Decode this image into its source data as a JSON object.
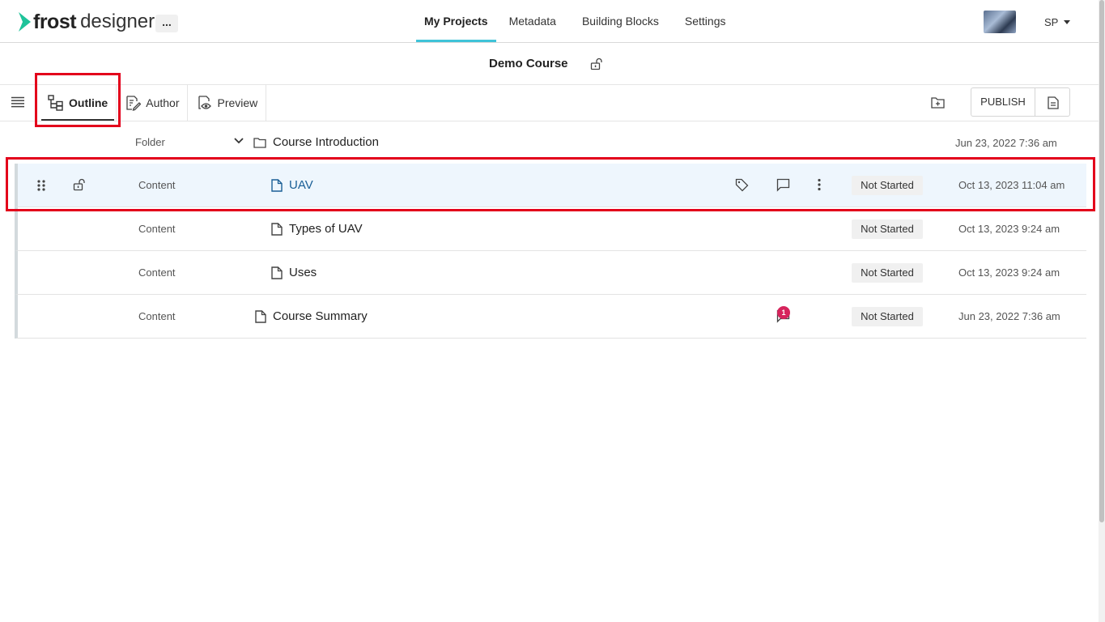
{
  "header": {
    "brand_bold": "frost",
    "brand_light": "designer",
    "more_label": "...",
    "nav": [
      {
        "label": "My Projects",
        "active": true
      },
      {
        "label": "Metadata",
        "active": false
      },
      {
        "label": "Building Blocks",
        "active": false
      },
      {
        "label": "Settings",
        "active": false
      }
    ],
    "user_initials": "SP"
  },
  "course": {
    "title": "Demo Course"
  },
  "toolbar": {
    "tabs": [
      {
        "label": "Outline",
        "active": true
      },
      {
        "label": "Author",
        "active": false
      },
      {
        "label": "Preview",
        "active": false
      }
    ],
    "publish_label": "PUBLISH"
  },
  "outline": {
    "rows": [
      {
        "type": "Folder",
        "title": "Course Introduction",
        "status": "",
        "date": "Jun 23, 2022 7:36 am"
      },
      {
        "type": "Content",
        "title": "UAV",
        "status": "Not Started",
        "date": "Oct 13, 2023 11:04 am"
      },
      {
        "type": "Content",
        "title": "Types of UAV",
        "status": "Not Started",
        "date": "Oct 13, 2023 9:24 am"
      },
      {
        "type": "Content",
        "title": "Uses",
        "status": "Not Started",
        "date": "Oct 13, 2023 9:24 am"
      },
      {
        "type": "Content",
        "title": "Course Summary",
        "status": "Not Started",
        "date": "Jun 23, 2022 7:36 am",
        "comment_count": "1"
      }
    ]
  },
  "colors": {
    "accent": "#3fc3d8",
    "highlight": "#e3001b",
    "selected_row": "#eef6fd",
    "link": "#1a5f96",
    "badge": "#d6245c"
  }
}
